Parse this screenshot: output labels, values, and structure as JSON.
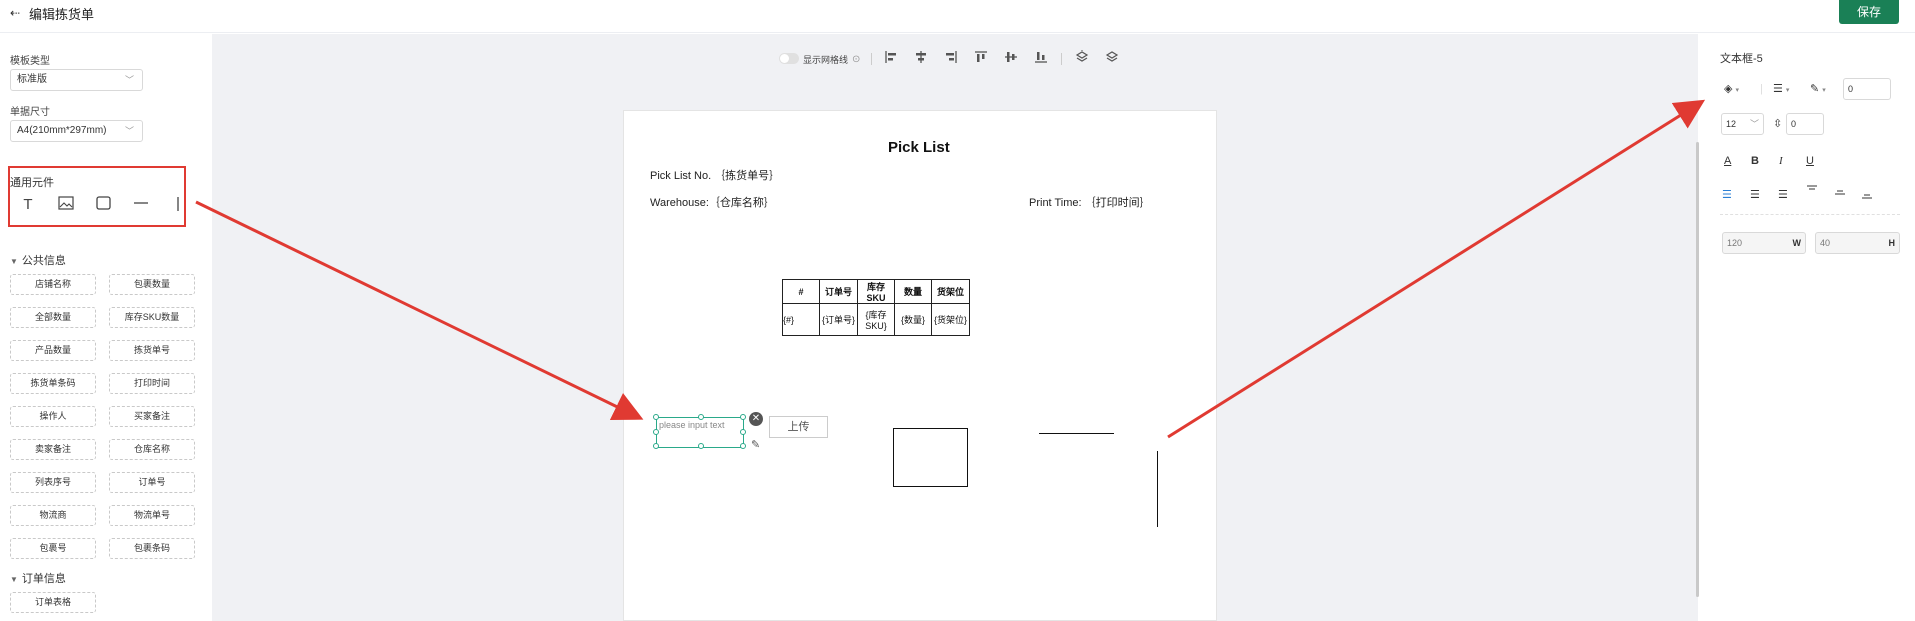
{
  "header": {
    "title": "编辑拣货单",
    "save_label": "保存"
  },
  "left": {
    "template_type_label": "模板类型",
    "template_type_value": "标准版",
    "paper_size_label": "单据尺寸",
    "paper_size_value": "A4(210mm*297mm)",
    "generic_title": "通用元件",
    "public_section": "公共信息",
    "public_items": [
      "店铺名称",
      "包裹数量",
      "全部数量",
      "库存SKU数量",
      "产品数量",
      "拣货单号",
      "拣货单条码",
      "打印时间",
      "操作人",
      "买家备注",
      "卖家备注",
      "仓库名称",
      "列表序号",
      "订单号",
      "物流商",
      "物流单号",
      "包裹号",
      "包裹条码"
    ],
    "order_section": "订单信息",
    "order_items": [
      "订单表格"
    ]
  },
  "toolbar": {
    "grid_label": "显示网格线"
  },
  "doc": {
    "title": "Pick List",
    "picklist_no": "Pick List No. ｛拣货单号｝",
    "warehouse": "Warehouse:｛仓库名称｝",
    "print_time": "Print Time: ｛打印时间｝",
    "table_headers": [
      "#",
      "订单号",
      "库存SKU",
      "数量",
      "货架位"
    ],
    "table_row": [
      "{#}",
      "{订单号}",
      "{库存SKU}",
      "{数量}",
      "{货架位}"
    ],
    "text_placeholder": "please input text",
    "upload_label": "上传"
  },
  "right": {
    "title": "文本框-5",
    "border_width": "0",
    "font_size": "12",
    "line_spacing": "0",
    "width": "120",
    "width_suffix": "W",
    "height": "40",
    "height_suffix": "H"
  },
  "colors": {
    "save_bg": "#1a8056",
    "arrow": "#e03a32",
    "selection": "#2aa98a"
  }
}
